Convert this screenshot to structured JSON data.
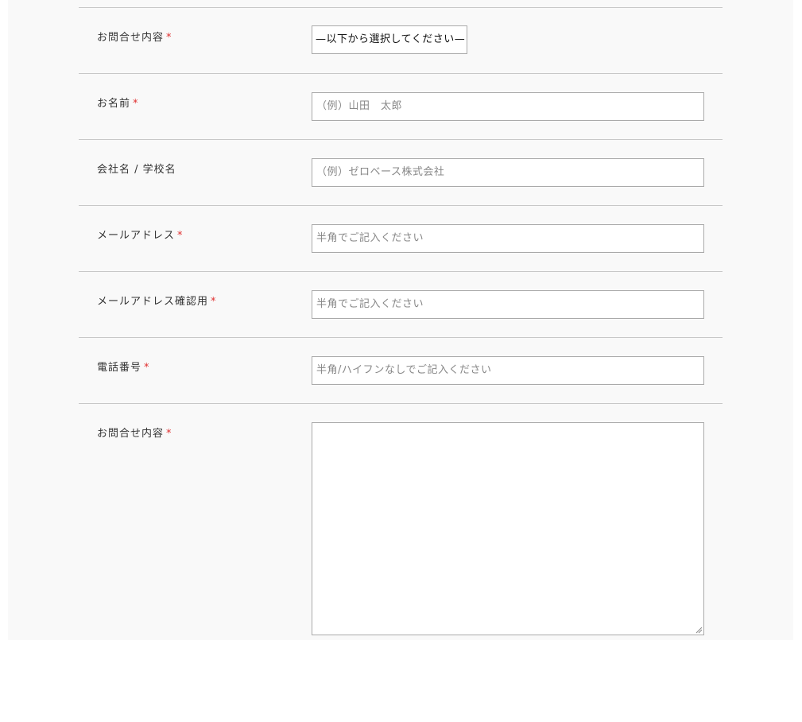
{
  "form": {
    "rows": [
      {
        "label": "お問合せ内容",
        "required_mark": "*",
        "control": "select",
        "value": "—以下から選択してください—"
      },
      {
        "label": "お名前",
        "required_mark": "*",
        "control": "input",
        "placeholder": "（例）山田　太郎"
      },
      {
        "label": "会社名 / 学校名",
        "required_mark": "",
        "control": "input",
        "placeholder": "（例）ゼロベース株式会社"
      },
      {
        "label": "メールアドレス",
        "required_mark": "*",
        "control": "input",
        "placeholder": "半角でご記入ください"
      },
      {
        "label": "メールアドレス確認用",
        "required_mark": "*",
        "control": "input",
        "placeholder": "半角でご記入ください"
      },
      {
        "label": "電話番号",
        "required_mark": "*",
        "control": "input",
        "placeholder": "半角/ハイフンなしでご記入ください"
      },
      {
        "label": "お問合せ内容",
        "required_mark": "*",
        "control": "textarea",
        "value": ""
      }
    ]
  },
  "colors": {
    "background": "#f9f9f9",
    "divider": "#c8c8c8",
    "input_border": "#aaaaaa",
    "required": "#e03030",
    "placeholder": "#888888"
  }
}
